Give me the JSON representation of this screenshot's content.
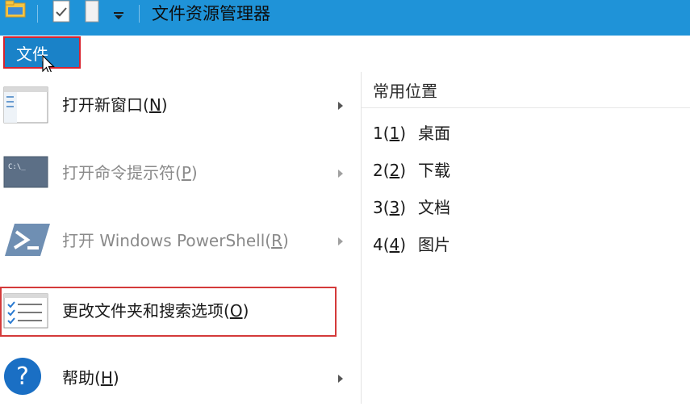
{
  "window": {
    "title": "文件资源管理器"
  },
  "ribbon": {
    "file_tab": "文件"
  },
  "menu": {
    "items": [
      {
        "name": "open-new-window",
        "label": "打开新窗口",
        "accel": "N",
        "disabled": false,
        "has_submenu": true,
        "icon": "window-icon"
      },
      {
        "name": "open-command-prompt",
        "label": "打开命令提示符",
        "accel": "P",
        "disabled": true,
        "has_submenu": true,
        "icon": "command-prompt-icon"
      },
      {
        "name": "open-powershell",
        "label": "打开 Windows PowerShell",
        "accel": "R",
        "disabled": true,
        "has_submenu": true,
        "icon": "powershell-icon"
      },
      {
        "name": "folder-options",
        "label": "更改文件夹和搜索选项",
        "accel": "O",
        "disabled": false,
        "has_submenu": false,
        "icon": "options-checklist-icon"
      },
      {
        "name": "help",
        "label": "帮助",
        "accel": "H",
        "disabled": false,
        "has_submenu": true,
        "icon": "help-icon"
      }
    ]
  },
  "frequent_places": {
    "header": "常用位置",
    "items": [
      {
        "index": "1",
        "accel": "1",
        "label": "桌面"
      },
      {
        "index": "2",
        "accel": "2",
        "label": "下载"
      },
      {
        "index": "3",
        "accel": "3",
        "label": "文档"
      },
      {
        "index": "4",
        "accel": "4",
        "label": "图片"
      }
    ]
  },
  "colors": {
    "titlebar": "#1f93d8",
    "file_tab": "#1a82c8",
    "highlight": "#d43a3a"
  }
}
